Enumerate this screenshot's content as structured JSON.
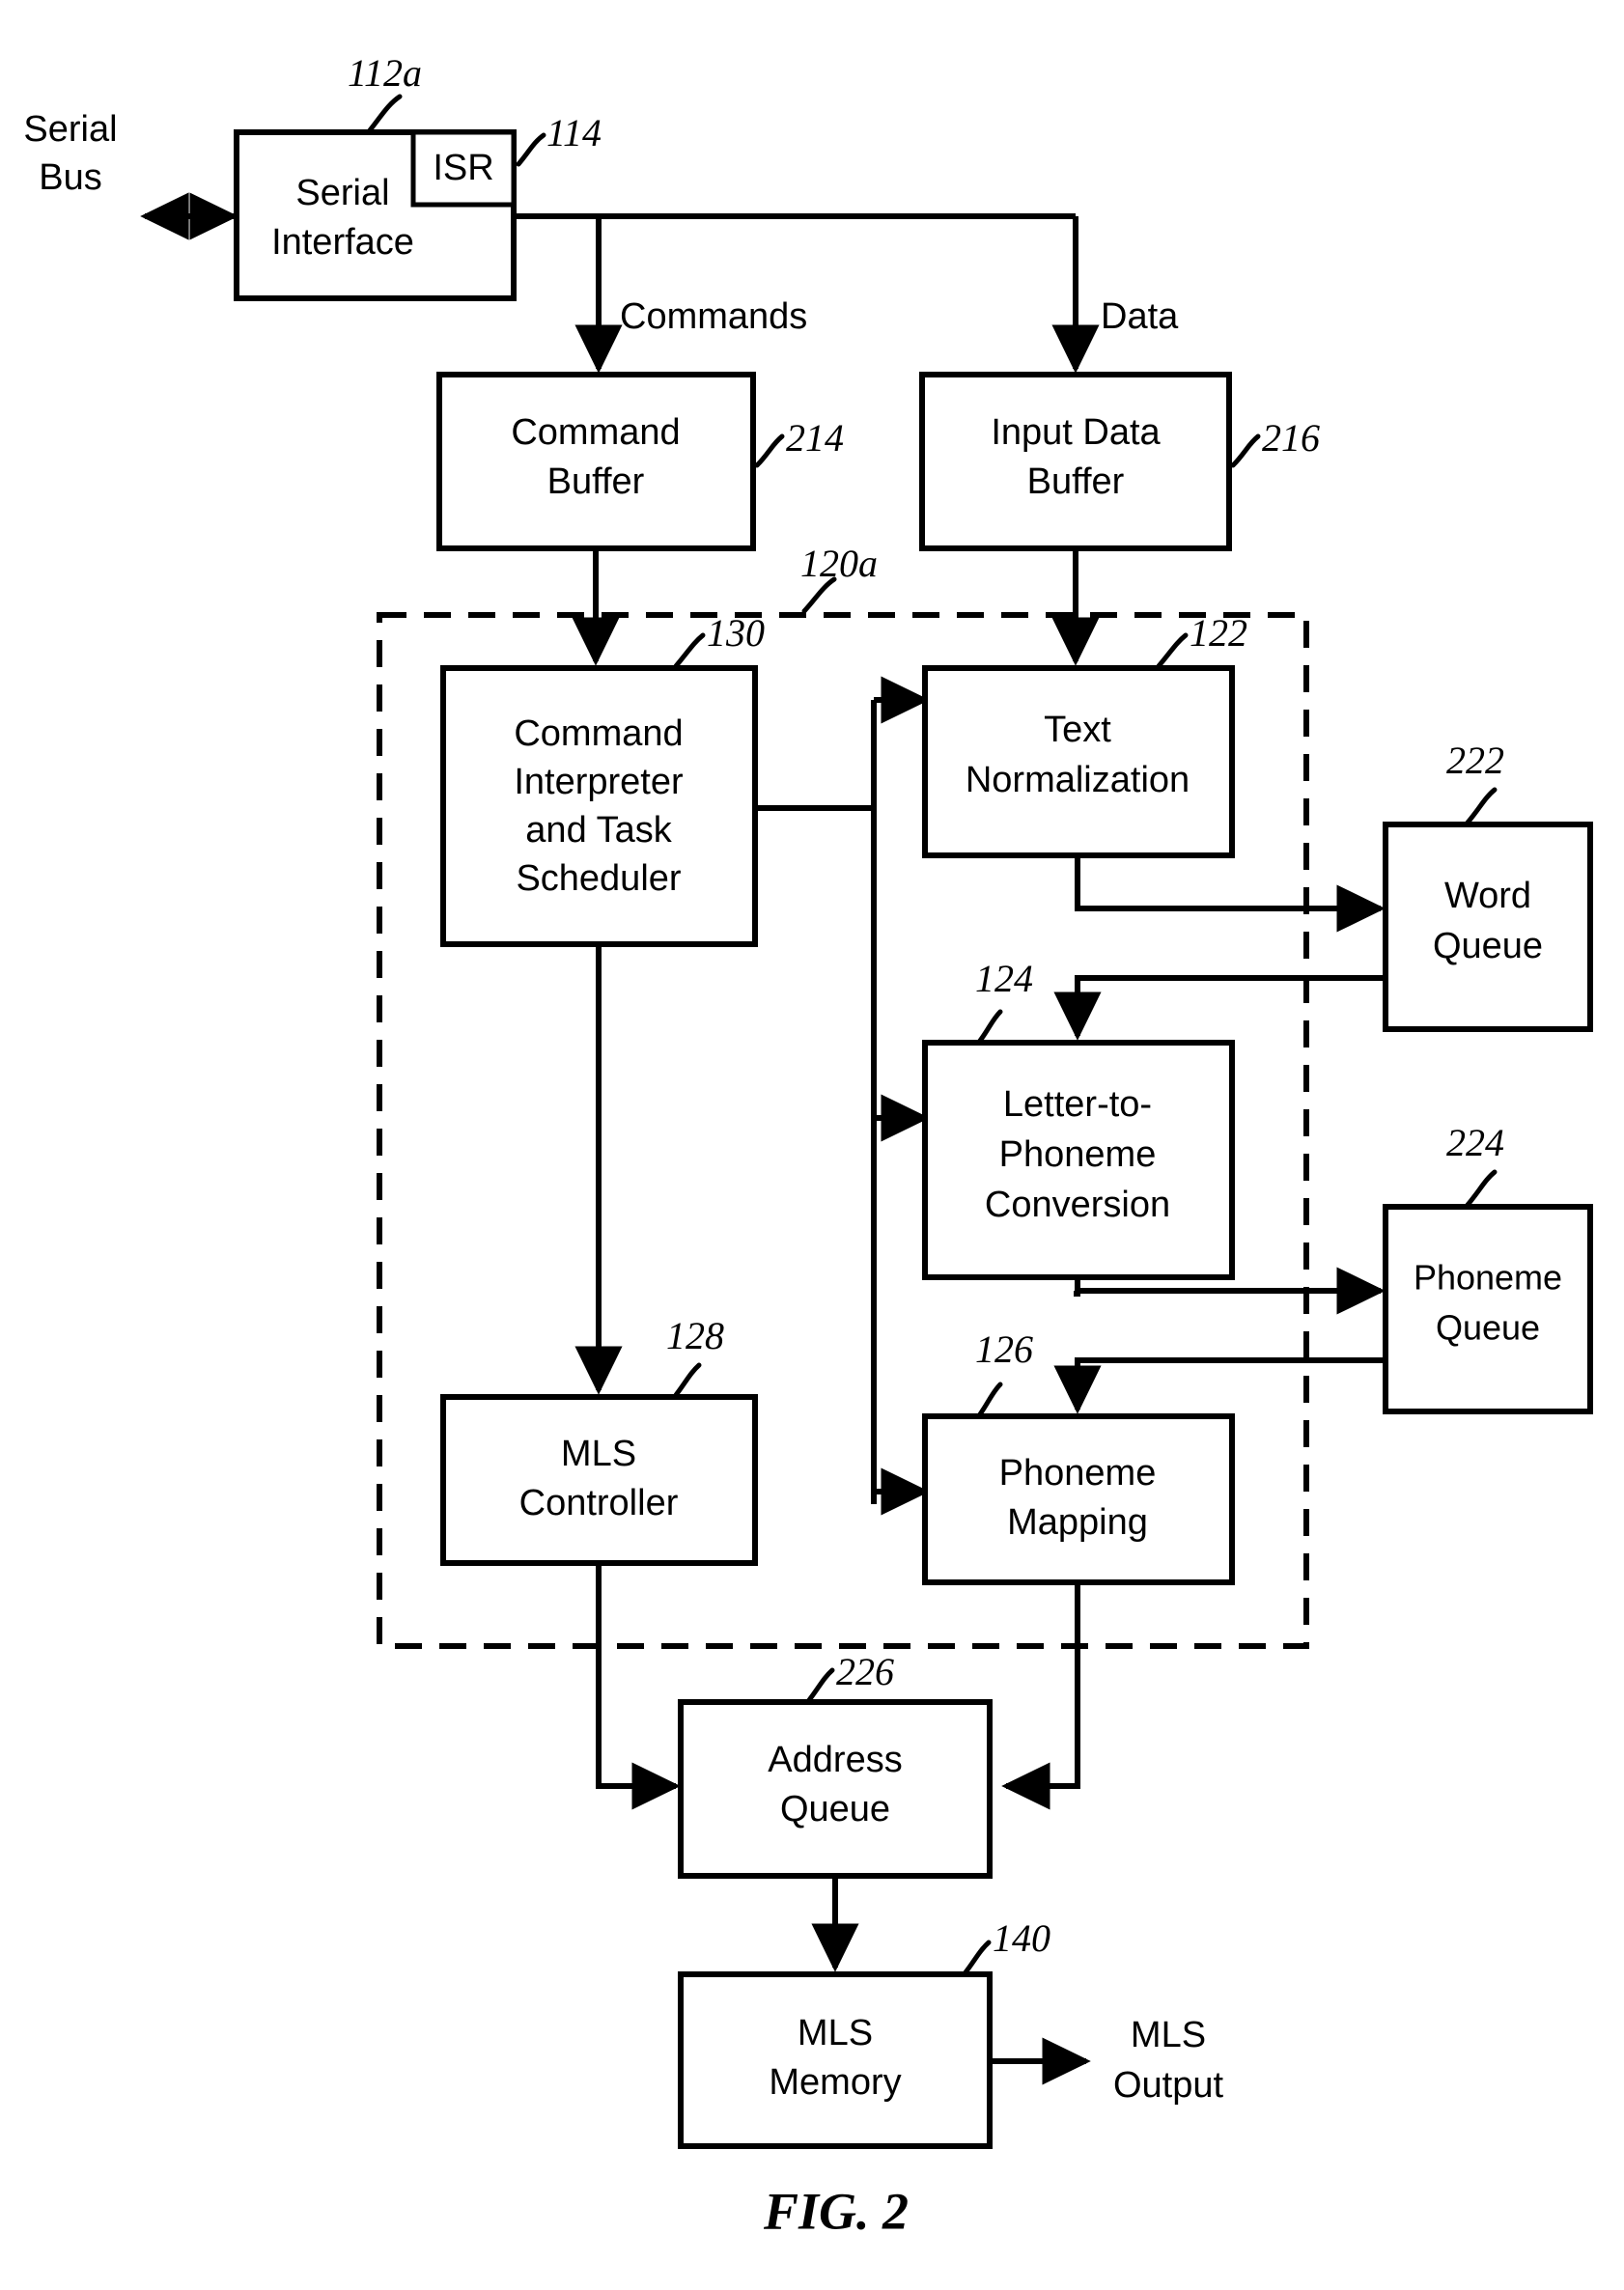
{
  "figure": {
    "caption": "FIG. 2",
    "external_labels": {
      "serial_bus": "Serial\nBus",
      "serial_bus_line1": "Serial",
      "serial_bus_line2": "Bus",
      "mls_output_line1": "MLS",
      "mls_output_line2": "Output"
    },
    "edge_labels": {
      "commands": "Commands",
      "data": "Data"
    }
  },
  "blocks": {
    "serial_interface": {
      "label_line1": "Serial",
      "label_line2": "Interface",
      "ref": "112a"
    },
    "isr": {
      "label": "ISR",
      "ref": "114"
    },
    "command_buffer": {
      "label_line1": "Command",
      "label_line2": "Buffer",
      "ref": "214"
    },
    "input_data_buffer": {
      "label_line1": "Input Data",
      "label_line2": "Buffer",
      "ref": "216"
    },
    "dashed_region": {
      "ref": "120a"
    },
    "command_interpreter": {
      "label_line1": "Command",
      "label_line2": "Interpreter",
      "label_line3": "and Task",
      "label_line4": "Scheduler",
      "ref": "130"
    },
    "text_normalization": {
      "label_line1": "Text",
      "label_line2": "Normalization",
      "ref": "122"
    },
    "letter_to_phoneme": {
      "label_line1": "Letter-to-",
      "label_line2": "Phoneme",
      "label_line3": "Conversion",
      "ref": "124"
    },
    "phoneme_mapping": {
      "label_line1": "Phoneme",
      "label_line2": "Mapping",
      "ref": "126"
    },
    "mls_controller": {
      "label_line1": "MLS",
      "label_line2": "Controller",
      "ref": "128"
    },
    "word_queue": {
      "label_line1": "Word",
      "label_line2": "Queue",
      "ref": "222"
    },
    "phoneme_queue": {
      "label_line1": "Phoneme",
      "label_line2": "Queue",
      "ref": "224"
    },
    "address_queue": {
      "label_line1": "Address",
      "label_line2": "Queue",
      "ref": "226"
    },
    "mls_memory": {
      "label_line1": "MLS",
      "label_line2": "Memory",
      "ref": "140"
    }
  },
  "colors": {
    "ink": "#000000",
    "paper": "#ffffff"
  }
}
